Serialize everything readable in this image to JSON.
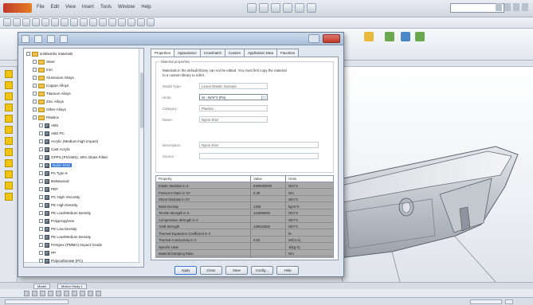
{
  "app": {
    "menus": [
      "File",
      "Edit",
      "View",
      "Insert",
      "Tools",
      "Window",
      "Help"
    ],
    "search_placeholder": ""
  },
  "ribbon": {
    "buttons": [
      {
        "label": "",
        "icon": "ribbon-tool-icon",
        "color": "#e8b93a"
      },
      {
        "label": "",
        "icon": "ribbon-tool-icon",
        "color": "#6aa84f"
      },
      {
        "label": "",
        "icon": "ribbon-tool-icon",
        "color": "#4a86c8"
      },
      {
        "label": "",
        "icon": "ribbon-tool-icon",
        "color": "#6aa84f"
      }
    ]
  },
  "dialog": {
    "tree": [
      {
        "label": "solidworks materials",
        "level": 0,
        "kind": "folder"
      },
      {
        "label": "Steel",
        "level": 1,
        "kind": "folder"
      },
      {
        "label": "Iron",
        "level": 1,
        "kind": "folder"
      },
      {
        "label": "Aluminium Alloys",
        "level": 1,
        "kind": "folder"
      },
      {
        "label": "Copper Alloys",
        "level": 1,
        "kind": "folder"
      },
      {
        "label": "Titanium Alloys",
        "level": 1,
        "kind": "folder"
      },
      {
        "label": "Zinc Alloys",
        "level": 1,
        "kind": "folder"
      },
      {
        "label": "Other Alloys",
        "level": 1,
        "kind": "folder"
      },
      {
        "label": "Plastics",
        "level": 1,
        "kind": "folder"
      },
      {
        "label": "ABS",
        "level": 2,
        "kind": "material"
      },
      {
        "label": "ABS PC",
        "level": 2,
        "kind": "material"
      },
      {
        "label": "Acrylic (Medium-high impact)",
        "level": 2,
        "kind": "material"
      },
      {
        "label": "Cast Acrylic",
        "level": 2,
        "kind": "material"
      },
      {
        "label": "GPPS (PS/ABS), 40% Glass Filled",
        "level": 2,
        "kind": "material"
      },
      {
        "label": "Nylon 6/10",
        "level": 2,
        "kind": "material",
        "selected": true
      },
      {
        "label": "PA Type 6",
        "level": 2,
        "kind": "material"
      },
      {
        "label": "Balsawood",
        "level": 2,
        "kind": "material"
      },
      {
        "label": "PBT",
        "level": 2,
        "kind": "material"
      },
      {
        "label": "PC High Viscosity",
        "level": 2,
        "kind": "material"
      },
      {
        "label": "PE High Density",
        "level": 2,
        "kind": "material"
      },
      {
        "label": "PE Low/Medium Density",
        "level": 2,
        "kind": "material"
      },
      {
        "label": "Polypropylene",
        "level": 2,
        "kind": "material"
      },
      {
        "label": "PE Low Density",
        "level": 2,
        "kind": "material"
      },
      {
        "label": "PE Low/Medium Density",
        "level": 2,
        "kind": "material"
      },
      {
        "label": "Perspex (PMMA) Impact Grade",
        "level": 2,
        "kind": "material"
      },
      {
        "label": "PP",
        "level": 2,
        "kind": "material"
      },
      {
        "label": "Polycarbonate (PC)",
        "level": 2,
        "kind": "material"
      }
    ],
    "tabs": [
      "Properties",
      "Appearance",
      "Crosshatch",
      "Custom",
      "Application Data",
      "Favorites"
    ],
    "group_legend": "Material properties",
    "info_text": "Materials in the default library can not be edited. You must first copy the material to a custom library to edit it.",
    "fields": {
      "model_type_label": "Model Type:",
      "model_type_value": "Linear Elastic Isotropic",
      "units_label": "Units:",
      "units_value": "SI - N/m^2 (Pa)",
      "category_label": "Category:",
      "category_value": "Plastics",
      "name_label": "Name:",
      "name_value": "Nylon 6/10",
      "description_label": "Description:",
      "description_value": "Nylon 6/10",
      "source_label": "Source:",
      "source_value": ""
    },
    "table": {
      "headers": [
        "Property",
        "Value",
        "Units"
      ],
      "rows": [
        [
          "Elastic Modulus in X",
          "8300000000",
          "N/m^2"
        ],
        [
          "Poisson's Ratio in XY",
          "0.28",
          "N/A"
        ],
        [
          "Shear Modulus in XY",
          "",
          "N/m^2"
        ],
        [
          "Mass Density",
          "1400",
          "kg/m^3"
        ],
        [
          "Tensile Strength in X",
          "142559000",
          "N/m^2"
        ],
        [
          "Compressive Strength in X",
          "",
          "N/m^2"
        ],
        [
          "Yield Strength",
          "139043000",
          "N/m^2"
        ],
        [
          "Thermal Expansion Coefficient in X",
          "",
          "/K"
        ],
        [
          "Thermal Conductivity in X",
          "0.53",
          "W/(m·K)"
        ],
        [
          "Specific Heat",
          "",
          "J/(kg·K)"
        ],
        [
          "Material Damping Ratio",
          "",
          "N/A"
        ]
      ]
    },
    "buttons": [
      "Apply",
      "Close",
      "Save",
      "Config...",
      "Help"
    ]
  },
  "bottom_tabs": [
    "Model",
    "Motion Study 1"
  ]
}
